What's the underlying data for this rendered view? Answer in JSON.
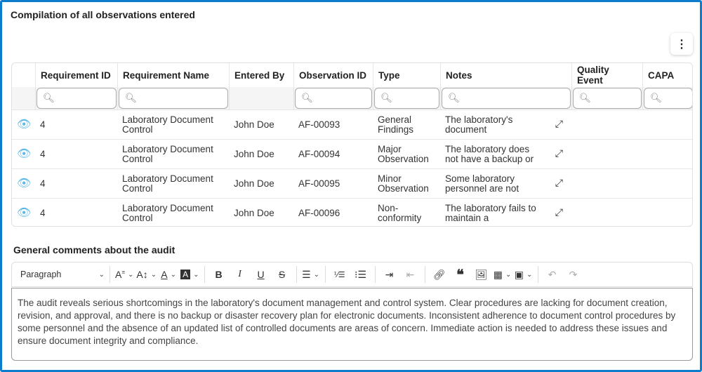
{
  "title": "Compilation of all observations entered",
  "columns": [
    "Requirement ID",
    "Requirement Name",
    "Entered By",
    "Observation ID",
    "Type",
    "Notes",
    "Quality Event",
    "CAPA"
  ],
  "rows": [
    {
      "req_id": "4",
      "req_name": "Laboratory Document Control",
      "entered_by": "John Doe",
      "obs_id": "AF-00093",
      "type": "General Findings",
      "notes": "The laboratory's document"
    },
    {
      "req_id": "4",
      "req_name": "Laboratory Document Control",
      "entered_by": "John Doe",
      "obs_id": "AF-00094",
      "type": "Major Observation",
      "notes": "The laboratory does not have a backup or"
    },
    {
      "req_id": "4",
      "req_name": "Laboratory Document Control",
      "entered_by": "John Doe",
      "obs_id": "AF-00095",
      "type": "Minor Observation",
      "notes": "Some laboratory personnel are not"
    },
    {
      "req_id": "4",
      "req_name": "Laboratory Document Control",
      "entered_by": "John Doe",
      "obs_id": "AF-00096",
      "type": "Non-conformity",
      "notes": "The laboratory fails to maintain a"
    }
  ],
  "comments_title": "General comments about the audit",
  "toolbar": {
    "paragraph": "Paragraph"
  },
  "comment_text": "The audit reveals serious shortcomings in the laboratory's document management and control system. Clear procedures are lacking for document creation, revision, and approval, and there is no backup or disaster recovery plan for electronic documents. Inconsistent adherence to document control procedures by some personnel and the absence of an updated list of controlled documents are areas of concern. Immediate action is needed to address these issues and ensure document integrity and compliance."
}
